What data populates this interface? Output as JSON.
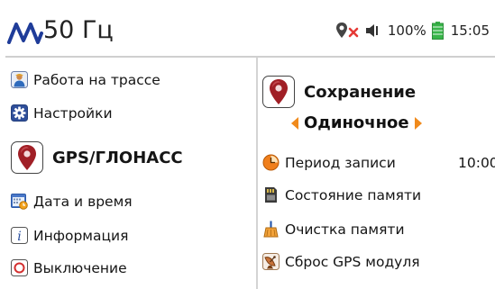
{
  "status": {
    "frequency": "50 Гц",
    "battery_percent": "100%",
    "time": "15:05",
    "icons": [
      "signal-logo-icon",
      "gps-disabled-icon",
      "speaker-icon",
      "battery-icon"
    ]
  },
  "left_menu": {
    "work": "Работа на трассе",
    "settings": "Настройки",
    "gps": "GPS/ГЛОНАСС",
    "datetime": "Дата и время",
    "info": "Информация",
    "shutdown": "Выключение"
  },
  "right_panel": {
    "title": "Сохранение",
    "mode": "Одиночное",
    "period_label": "Период записи",
    "period_value": "10:00",
    "memory_status": "Состояние памяти",
    "memory_clear": "Очистка памяти",
    "gps_reset": "Сброс GPS модуля"
  },
  "colors": {
    "pin_red": "#a01f26",
    "arrow_orange": "#f08a1c",
    "battery_green": "#39b54a",
    "logo_blue": "#1f3c99"
  }
}
